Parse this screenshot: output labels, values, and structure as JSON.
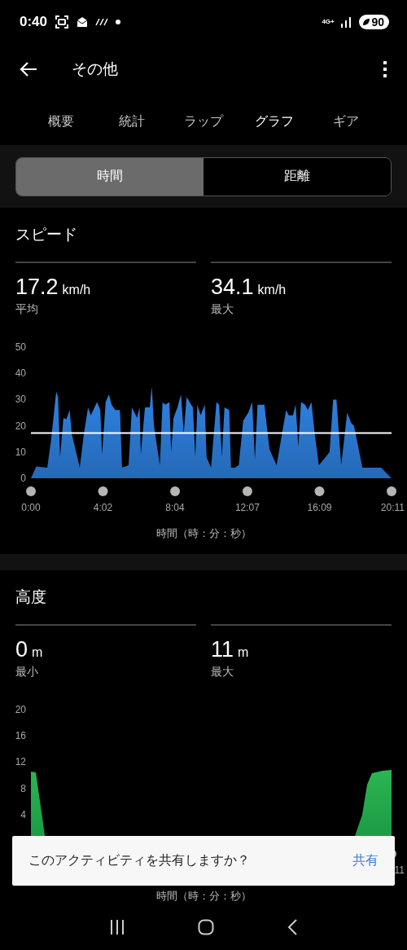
{
  "status_bar": {
    "time": "0:40",
    "network": "4G+",
    "battery": "90"
  },
  "header": {
    "title": "その他"
  },
  "tabs": [
    {
      "label": "概要",
      "selected": false
    },
    {
      "label": "統計",
      "selected": false
    },
    {
      "label": "ラップ",
      "selected": false
    },
    {
      "label": "グラフ",
      "selected": true
    },
    {
      "label": "ギア",
      "selected": false
    }
  ],
  "segments": [
    {
      "label": "時間",
      "selected": true
    },
    {
      "label": "距離",
      "selected": false
    }
  ],
  "sections": [
    {
      "title": "スピード",
      "stats": [
        {
          "value": "17.2",
          "unit": "km/h",
          "label": "平均"
        },
        {
          "value": "34.1",
          "unit": "km/h",
          "label": "最大"
        }
      ],
      "chart_data": {
        "type": "area",
        "xlabel": "時間（時：分：秒）",
        "xlim": [
          0,
          1211
        ],
        "ylim": [
          0,
          50
        ],
        "yticks": [
          0,
          10,
          20,
          30,
          40,
          50
        ],
        "xticks": [
          {
            "value": 0,
            "label": "0:00"
          },
          {
            "value": 242,
            "label": "4:02"
          },
          {
            "value": 484,
            "label": "8:04"
          },
          {
            "value": 727,
            "label": "12:07"
          },
          {
            "value": 969,
            "label": "16:09"
          },
          {
            "value": 1211,
            "label": "20:11"
          }
        ],
        "ref_lines": [
          {
            "axis": "y",
            "value": 17.2,
            "color": "#ffffff"
          }
        ],
        "series": [
          {
            "color": "#2f83e4",
            "x": [
              0,
              18,
              55,
              68,
              85,
              91,
              98,
              109,
              119,
              130,
              137,
              164,
              178,
              192,
              201,
              222,
              233,
              239,
              251,
              262,
              271,
              283,
              299,
              306,
              328,
              339,
              348,
              356,
              365,
              369,
              383,
              399,
              406,
              413,
              433,
              442,
              451,
              465,
              471,
              479,
              492,
              504,
              513,
              523,
              538,
              544,
              552,
              559,
              570,
              584,
              590,
              605,
              623,
              632,
              641,
              650,
              666,
              672,
              684,
              698,
              713,
              730,
              743,
              752,
              761,
              784,
              801,
              825,
              857,
              866,
              880,
              889,
              898,
              907,
              921,
              930,
              942,
              953,
              967,
              989,
              1003,
              1015,
              1026,
              1042,
              1062,
              1076,
              1085,
              1113,
              1131,
              1176,
              1211
            ],
            "values": [
              0,
              4.5,
              4,
              15,
              33,
              31,
              8,
              23,
              22.5,
              26,
              17,
              4,
              17,
              27,
              24,
              29,
              26,
              9,
              29,
              32,
              28,
              26,
              26,
              4,
              5,
              27,
              25,
              23,
              27,
              9,
              27,
              27,
              35,
              20,
              5,
              29,
              28,
              29,
              10,
              23,
              27,
              32,
              17,
              31,
              28,
              27,
              8,
              28,
              24,
              28,
              8,
              4,
              29,
              28,
              8,
              27,
              26,
              4,
              4,
              5,
              22,
              25,
              29,
              7,
              28,
              28,
              11,
              5,
              26,
              24,
              24,
              28,
              12,
              29,
              28,
              26,
              29,
              17,
              5,
              8,
              10,
              30,
              30,
              5,
              25,
              21,
              20,
              4,
              4,
              4,
              0
            ]
          }
        ]
      }
    },
    {
      "title": "高度",
      "stats": [
        {
          "value": "0",
          "unit": "m",
          "label": "最小"
        },
        {
          "value": "11",
          "unit": "m",
          "label": "最大"
        }
      ],
      "graph": {
        "kind": "picture",
        "y_labels": [
          "20",
          "16",
          "12",
          "8",
          "4"
        ],
        "x_label": "11",
        "axis_title": "時間（時：分：秒）"
      }
    }
  ],
  "dialog": {
    "message": "このアクティビティを共有しますか？",
    "action": "共有"
  }
}
